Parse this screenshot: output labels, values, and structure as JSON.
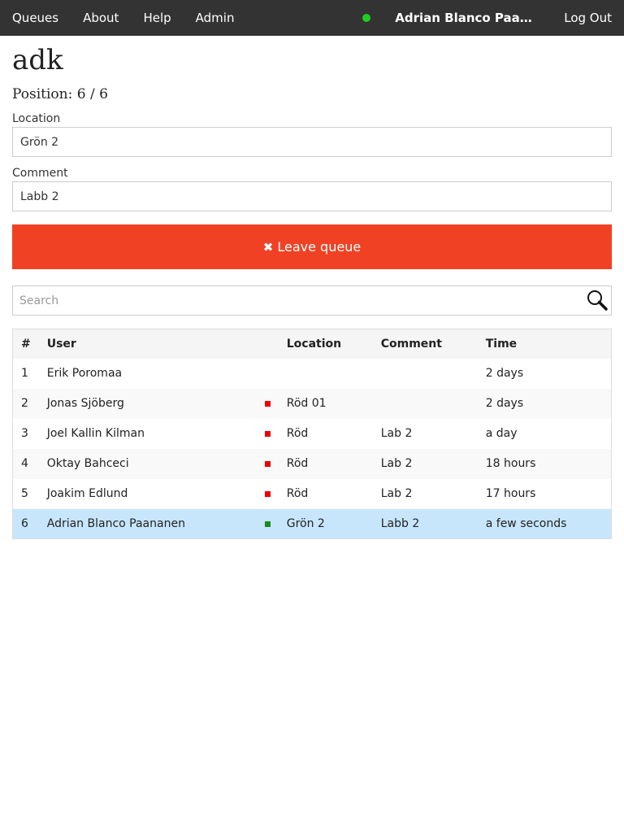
{
  "nav": {
    "links": [
      "Queues",
      "About",
      "Help",
      "Admin"
    ],
    "user": "Adrian Blanco Paananen",
    "logout": "Log Out",
    "online_color": "#1fce1f"
  },
  "queue": {
    "title": "adk",
    "position_label": "Position: 6 / 6"
  },
  "form": {
    "location_label": "Location",
    "location_value": "Grön 2",
    "comment_label": "Comment",
    "comment_value": "Labb 2",
    "leave_icon": "✖",
    "leave_label": "Leave queue",
    "leave_color": "#f04124"
  },
  "search": {
    "placeholder": "Search",
    "icon": "search-icon"
  },
  "table": {
    "headers": [
      "#",
      "User",
      "Location",
      "Comment",
      "Time"
    ],
    "rows": [
      {
        "num": "1",
        "user": "Erik Poromaa",
        "marker": "",
        "location": "",
        "comment": "",
        "time": "2 days"
      },
      {
        "num": "2",
        "user": "Jonas Sjöberg",
        "marker": "#ee0000",
        "location": "Röd 01",
        "comment": "",
        "time": "2 days"
      },
      {
        "num": "3",
        "user": "Joel Kallin Kilman",
        "marker": "#ee0000",
        "location": "Röd",
        "comment": "Lab 2",
        "time": "a day"
      },
      {
        "num": "4",
        "user": "Oktay Bahceci",
        "marker": "#ee0000",
        "location": "Röd",
        "comment": "Lab 2",
        "time": "18 hours"
      },
      {
        "num": "5",
        "user": "Joakim Edlund",
        "marker": "#ee0000",
        "location": "Röd",
        "comment": "Lab 2",
        "time": "17 hours"
      },
      {
        "num": "6",
        "user": "Adrian Blanco Paananen",
        "marker": "#1a8a1a",
        "location": "Grön 2",
        "comment": "Labb 2",
        "time": "a few seconds",
        "highlight": true
      }
    ]
  }
}
